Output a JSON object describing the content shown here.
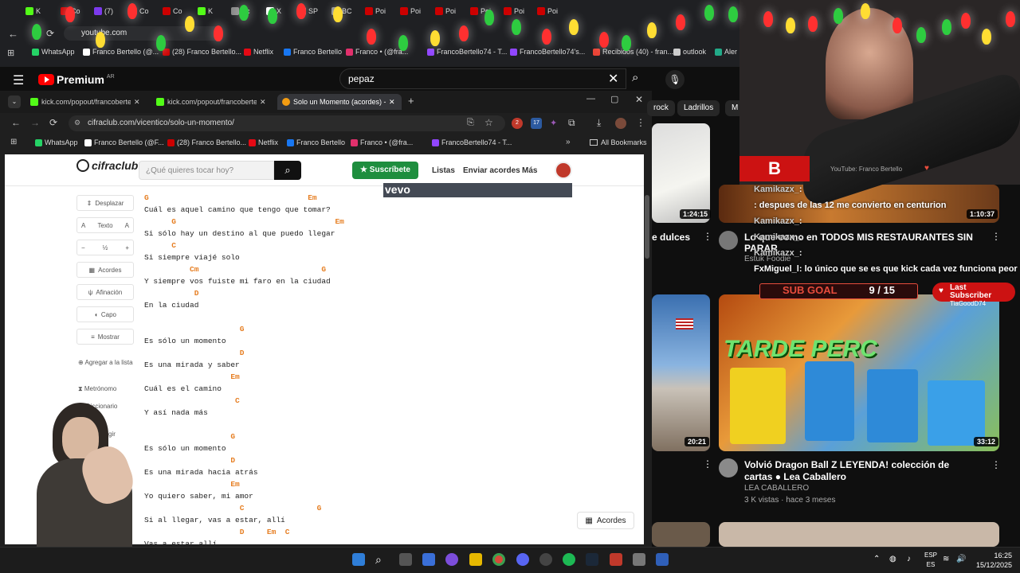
{
  "top_browser": {
    "tabs": [
      {
        "label": "K",
        "color": "#53fc18"
      },
      {
        "label": "Co",
        "color": "#cc0000"
      },
      {
        "label": "(7)",
        "color": "#7c3aed"
      },
      {
        "label": "Co",
        "color": "#cc0000"
      },
      {
        "label": "Co",
        "color": "#cc0000"
      },
      {
        "label": "K",
        "color": "#53fc18"
      },
      {
        "label": "Ac",
        "color": "#888888"
      },
      {
        "label": "X",
        "color": "#ffffff"
      },
      {
        "label": "SP",
        "color": "#888888"
      },
      {
        "label": "BC",
        "color": "#888888"
      },
      {
        "label": "Poi",
        "color": "#cc0000"
      },
      {
        "label": "Poi",
        "color": "#cc0000"
      },
      {
        "label": "Poi",
        "color": "#cc0000"
      },
      {
        "label": "Poi",
        "color": "#cc0000"
      },
      {
        "label": "Poi",
        "color": "#cc0000"
      },
      {
        "label": "Poi",
        "color": "#cc0000"
      }
    ],
    "url": "youtube.com",
    "bookmarks": [
      {
        "label": "WhatsApp",
        "color": "#25d366"
      },
      {
        "label": "Franco Bertello (@...",
        "color": "#ffffff"
      },
      {
        "label": "(28) Franco Bertello...",
        "color": "#cc0000"
      },
      {
        "label": "Netflix",
        "color": "#e50914"
      },
      {
        "label": "Franco Bertello",
        "color": "#1877f2"
      },
      {
        "label": "Franco • (@fra...",
        "color": "#e1306c"
      },
      {
        "label": "FrancoBertello74 - T...",
        "color": "#9146ff"
      },
      {
        "label": "FrancoBertello74's...",
        "color": "#9146ff"
      },
      {
        "label": "Recibidos (40) - fran...",
        "color": "#ea4335"
      },
      {
        "label": "outlook",
        "color": "#cccccc"
      },
      {
        "label": "Aler",
        "color": "#22aa88"
      }
    ]
  },
  "youtube": {
    "logo": "Premium",
    "region": "AR",
    "search_value": "pepaz",
    "chips": [
      "rock",
      "Ladrillos",
      "M"
    ],
    "videos": [
      {
        "duration": "1:24:15"
      },
      {
        "title": "e dulces"
      },
      {
        "duration": "1:10:37"
      },
      {
        "title": "Lo que como en TODOS MIS RESTAURANTES SIN PARAR",
        "channel": "Estuk Foodie"
      },
      {
        "duration": "20:21"
      },
      {
        "duration": "33:12",
        "title": "Volvió Dragon Ball Z LEYENDA! colección de cartas ● Lea Caballero",
        "channel": "LEA CABALLERO",
        "meta": "3 K vistas · hace 3 meses"
      }
    ]
  },
  "inner_browser": {
    "tabs": [
      {
        "label": "kick.com/popout/francobertello",
        "color": "#53fc18"
      },
      {
        "label": "kick.com/popout/francobertello",
        "color": "#53fc18"
      },
      {
        "label": "Solo un Momento (acordes) - V",
        "color": "#f39c12"
      }
    ],
    "url": "cifraclub.com/vicentico/solo-un-momento/",
    "ext_badges": [
      "2",
      "17"
    ],
    "bookmarks": [
      {
        "label": "WhatsApp",
        "color": "#25d366"
      },
      {
        "label": "Franco Bertello (@F...",
        "color": "#ffffff"
      },
      {
        "label": "(28) Franco Bertello...",
        "color": "#cc0000"
      },
      {
        "label": "Netflix",
        "color": "#e50914"
      },
      {
        "label": "Franco Bertello",
        "color": "#1877f2"
      },
      {
        "label": "Franco • (@fra...",
        "color": "#e1306c"
      },
      {
        "label": "FrancoBertello74 - T...",
        "color": "#9146ff"
      }
    ],
    "all_bookmarks": "All Bookmarks"
  },
  "cifraclub": {
    "logo": "cifraclub",
    "search_placeholder": "¿Qué quieres tocar hoy?",
    "subscribe": "Suscríbete",
    "nav": [
      "Listas",
      "Enviar acordes",
      "Más"
    ],
    "vevo": "vevo",
    "sidebar": {
      "desplazar": "Desplazar",
      "texto": "Texto",
      "half": "½",
      "acordes": "Acordes",
      "afinacion": "Afinación",
      "capo": "Capo",
      "mostrar": "Mostrar",
      "agregar": "Agregar a la lista",
      "metronomo": "Metrónomo",
      "diccionario": "Diccionario",
      "corregir": "Corregir",
      "imprimir": "Im"
    },
    "lines": [
      {
        "chords": "G                                   Em",
        "lyric": "Cuál es aquel camino que tengo que tomar?"
      },
      {
        "chords": "      G                                   Em",
        "lyric": "Si sólo hay un destino al que puedo llegar"
      },
      {
        "chords": "      C",
        "lyric": "Si siempre viajé solo"
      },
      {
        "chords": "          Cm                           G",
        "lyric": "Y siempre vos fuiste mi faro en la ciudad"
      },
      {
        "chords": "           D",
        "lyric": "En la ciudad"
      },
      {
        "chords": "                     G",
        "lyric": "Es sólo un momento"
      },
      {
        "chords": "                     D",
        "lyric": "Es una mirada y saber"
      },
      {
        "chords": "                   Em",
        "lyric": "Cuál es el camino"
      },
      {
        "chords": "                    C",
        "lyric": "Y así nada más"
      },
      {
        "chords": "                   G",
        "lyric": "Es sólo un momento"
      },
      {
        "chords": "                   D",
        "lyric": "Es una mirada hacia atrás"
      },
      {
        "chords": "                   Em",
        "lyric": "Yo quiero saber, mi amor"
      },
      {
        "chords": "                     C                G",
        "lyric": "Si al llegar, vas a estar, allí"
      },
      {
        "chords": "                     D     Em  C",
        "lyric": "Vas a estar allí"
      }
    ],
    "acordes_button": "Acordes"
  },
  "stream": {
    "channel_label": "YouTube: Franco Bertello",
    "chat": [
      {
        "name": "Kamikazx_",
        "msg": ":"
      },
      {
        "name": "",
        "msg": ": despues de las 12 me convierto en centurion"
      },
      {
        "name": "Kamikazx_",
        "msg": ":"
      },
      {
        "name": "Kamikazx_",
        "msg": ":"
      },
      {
        "name": "Kamikazx_",
        "msg": ":"
      },
      {
        "name": "FxMiguel_l",
        "msg": ": lo único que se es que kick cada vez funciona peor"
      }
    ],
    "sub_goal_label": "SUB GOAL",
    "sub_goal_value": "9 / 15",
    "last_sub_label": "Last Subscriber",
    "last_sub_name": "TiaGoodD74",
    "banner": "TARDE PERC"
  },
  "taskbar": {
    "lang": "ESP",
    "region": "ES",
    "time": "16:25",
    "date": "15/12/2025"
  }
}
